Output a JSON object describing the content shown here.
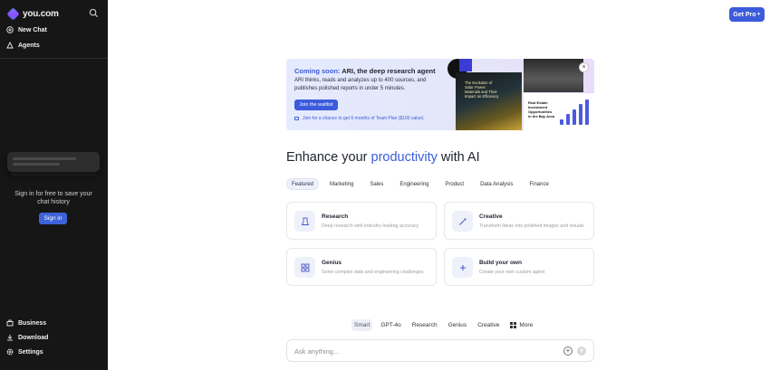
{
  "sidebar": {
    "logo": "you.com",
    "top_items": [
      {
        "label": "New Chat",
        "icon": "plus-circle-icon"
      },
      {
        "label": "Agents",
        "icon": "agents-icon"
      }
    ],
    "signin_prompt": "Sign in for free to save your chat history",
    "signin_button": "Sign in",
    "bottom_items": [
      {
        "label": "Business",
        "icon": "briefcase-icon"
      },
      {
        "label": "Download",
        "icon": "download-icon"
      },
      {
        "label": "Settings",
        "icon": "gear-icon"
      }
    ]
  },
  "header": {
    "get_pro": "Get Pro"
  },
  "banner": {
    "title_accent": "Coming soon:",
    "title_rest": " ARI, the deep research agent",
    "description": "ARI thinks, reads and analyzes up to 400 sources, and publishes polished reports in under 5 minutes.",
    "button": "Join the waitlist",
    "note": "Join for a chance to get 6 months of Team Plan ($100 value)",
    "image1_text": "The Evolution of Solar Power: Materials and Their Impact on Efficiency",
    "image3_text": "Real Estate Investment Opportunities in the Bay Area"
  },
  "headline": {
    "prefix": "Enhance your ",
    "accent": "productivity",
    "suffix": " with AI"
  },
  "categories": [
    "Featured",
    "Marketing",
    "Sales",
    "Engineering",
    "Product",
    "Data Analysis",
    "Finance"
  ],
  "cards": [
    {
      "title": "Research",
      "description": "Deep research with industry-leading accuracy",
      "icon": "research-icon"
    },
    {
      "title": "Creative",
      "description": "Transform ideas into polished images and visuals",
      "icon": "wand-icon"
    },
    {
      "title": "Genius",
      "description": "Solve complex data and engineering challenges",
      "icon": "grid-icon"
    },
    {
      "title": "Build your own",
      "description": "Create your own custom agent",
      "icon": "plus-icon"
    }
  ],
  "modes": [
    "Smart",
    "GPT-4o",
    "Research",
    "Genius",
    "Creative",
    "More"
  ],
  "input": {
    "placeholder": "Ask anything..."
  },
  "colors": {
    "accent": "#3b5bdb",
    "sidebar_bg": "#161616"
  }
}
